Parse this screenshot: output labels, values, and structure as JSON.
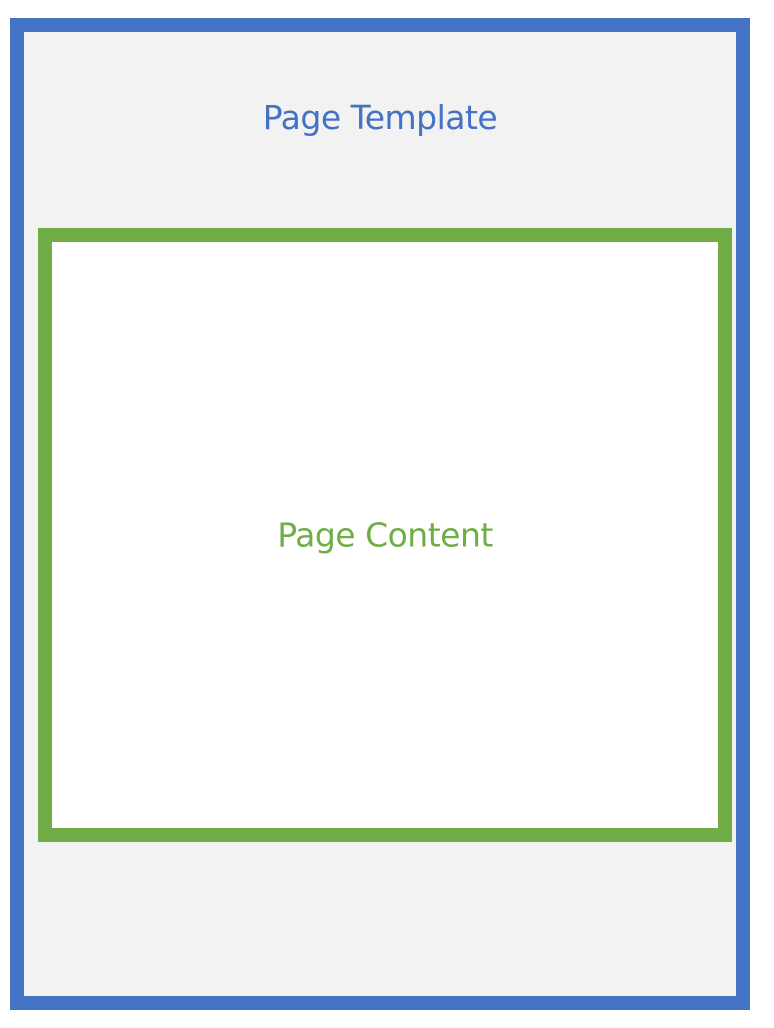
{
  "template": {
    "label": "Page Template",
    "border_color": "#4472C4",
    "fill_color": "#F2F2F2"
  },
  "content": {
    "label": "Page Content",
    "border_color": "#70AD47",
    "fill_color": "#FFFFFF"
  }
}
